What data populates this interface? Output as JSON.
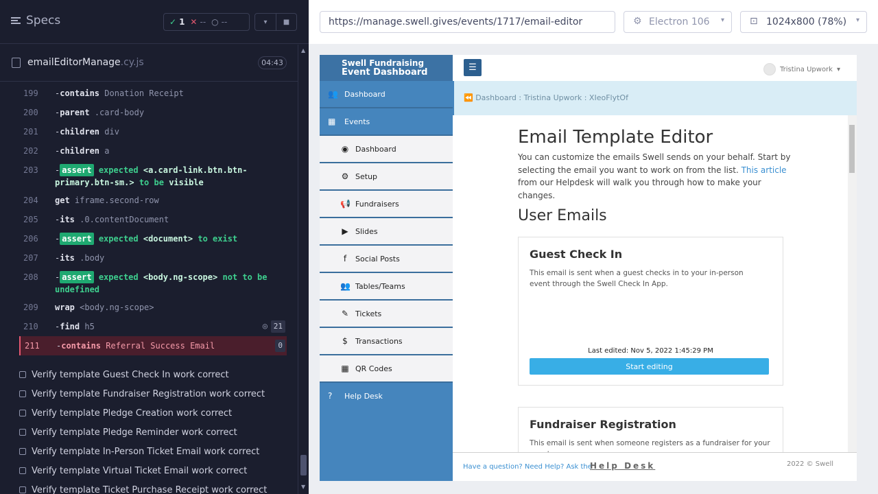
{
  "runner": {
    "title": "Specs",
    "stats": {
      "passed": "1",
      "failed": "--",
      "pending": "--"
    },
    "file": {
      "name": "emailEditorManage",
      "ext": ".cy.js"
    },
    "timer": "04:43",
    "commands": [
      {
        "num": "199",
        "dash": "-",
        "name": "contains",
        "arg": "Donation Receipt"
      },
      {
        "num": "200",
        "dash": "-",
        "name": "parent",
        "arg": ".card-body"
      },
      {
        "num": "201",
        "dash": "-",
        "name": "children",
        "arg": "div"
      },
      {
        "num": "202",
        "dash": "-",
        "name": "children",
        "arg": "a"
      },
      {
        "num": "203",
        "assert": "assert",
        "text1": "expected",
        "arg": "<a.card-link.btn.btn-primary.btn-sm.>",
        "text2": "to be",
        "text3": "visible"
      },
      {
        "num": "204",
        "name": "get",
        "arg": "iframe.second-row"
      },
      {
        "num": "205",
        "dash": "-",
        "name": "its",
        "arg": ".0.contentDocument"
      },
      {
        "num": "206",
        "assert": "assert",
        "text1": "expected",
        "arg": "<document>",
        "text2": "to exist"
      },
      {
        "num": "207",
        "dash": "-",
        "name": "its",
        "arg": ".body"
      },
      {
        "num": "208",
        "assert": "assert",
        "text1": "expected",
        "arg": "<body.ng-scope>",
        "text2": "not to be undefined"
      },
      {
        "num": "209",
        "name": "wrap",
        "arg": "<body.ng-scope>"
      },
      {
        "num": "210",
        "dash": "-",
        "name": "find",
        "arg": "h5",
        "count": "21"
      },
      {
        "num": "211",
        "dash": "-",
        "name": "contains",
        "arg": "Referral Success Email",
        "count": "0"
      }
    ],
    "tests": [
      "Verify template Guest Check In work correct",
      "Verify template Fundraiser Registration work correct",
      "Verify template Pledge Creation work correct",
      "Verify template Pledge Reminder work correct",
      "Verify template In-Person Ticket Email work correct",
      "Verify template Virtual Ticket Email work correct",
      "Verify template Ticket Purchase Receipt work correct"
    ]
  },
  "browser": {
    "url": "https://manage.swell.gives/events/1717/email-editor",
    "engine": "Electron 106",
    "viewport": "1024x800",
    "zoom": "(78%)"
  },
  "app": {
    "brand_line1": "Swell Fundraising",
    "brand_line2": "Event Dashboard",
    "user": "Tristina Upwork",
    "breadcrumb": "Dashboard : Tristina Upwork : XIeoFlytOf",
    "sidebar": {
      "dashboard": "Dashboard",
      "events": "Events",
      "sub": [
        "Dashboard",
        "Setup",
        "Fundraisers",
        "Slides",
        "Social Posts",
        "Tables/Teams",
        "Tickets",
        "Transactions",
        "QR Codes"
      ],
      "help": "Help Desk"
    },
    "page_title": "Email Template Editor",
    "intro_before": "You can customize the emails Swell sends on your behalf. Start by selecting the email you want to work on from the list. ",
    "intro_link": "This article",
    "intro_after": " from our Helpdesk will walk you through how to make your changes.",
    "section_title": "User Emails",
    "cards": [
      {
        "title": "Guest Check In",
        "desc": "This email is sent when a guest checks in to your in-person event through the Swell Check In App.",
        "edited": "Last edited: Nov 5, 2022 1:45:29 PM",
        "button": "Start editing"
      },
      {
        "title": "Fundraiser Registration",
        "desc": "This email is sent when someone registers as a fundraiser for your event"
      }
    ],
    "footer": {
      "question": "Have a question? Need Help? Ask the",
      "helpdesk": "Help Desk",
      "copyright": "2022 © Swell"
    }
  }
}
